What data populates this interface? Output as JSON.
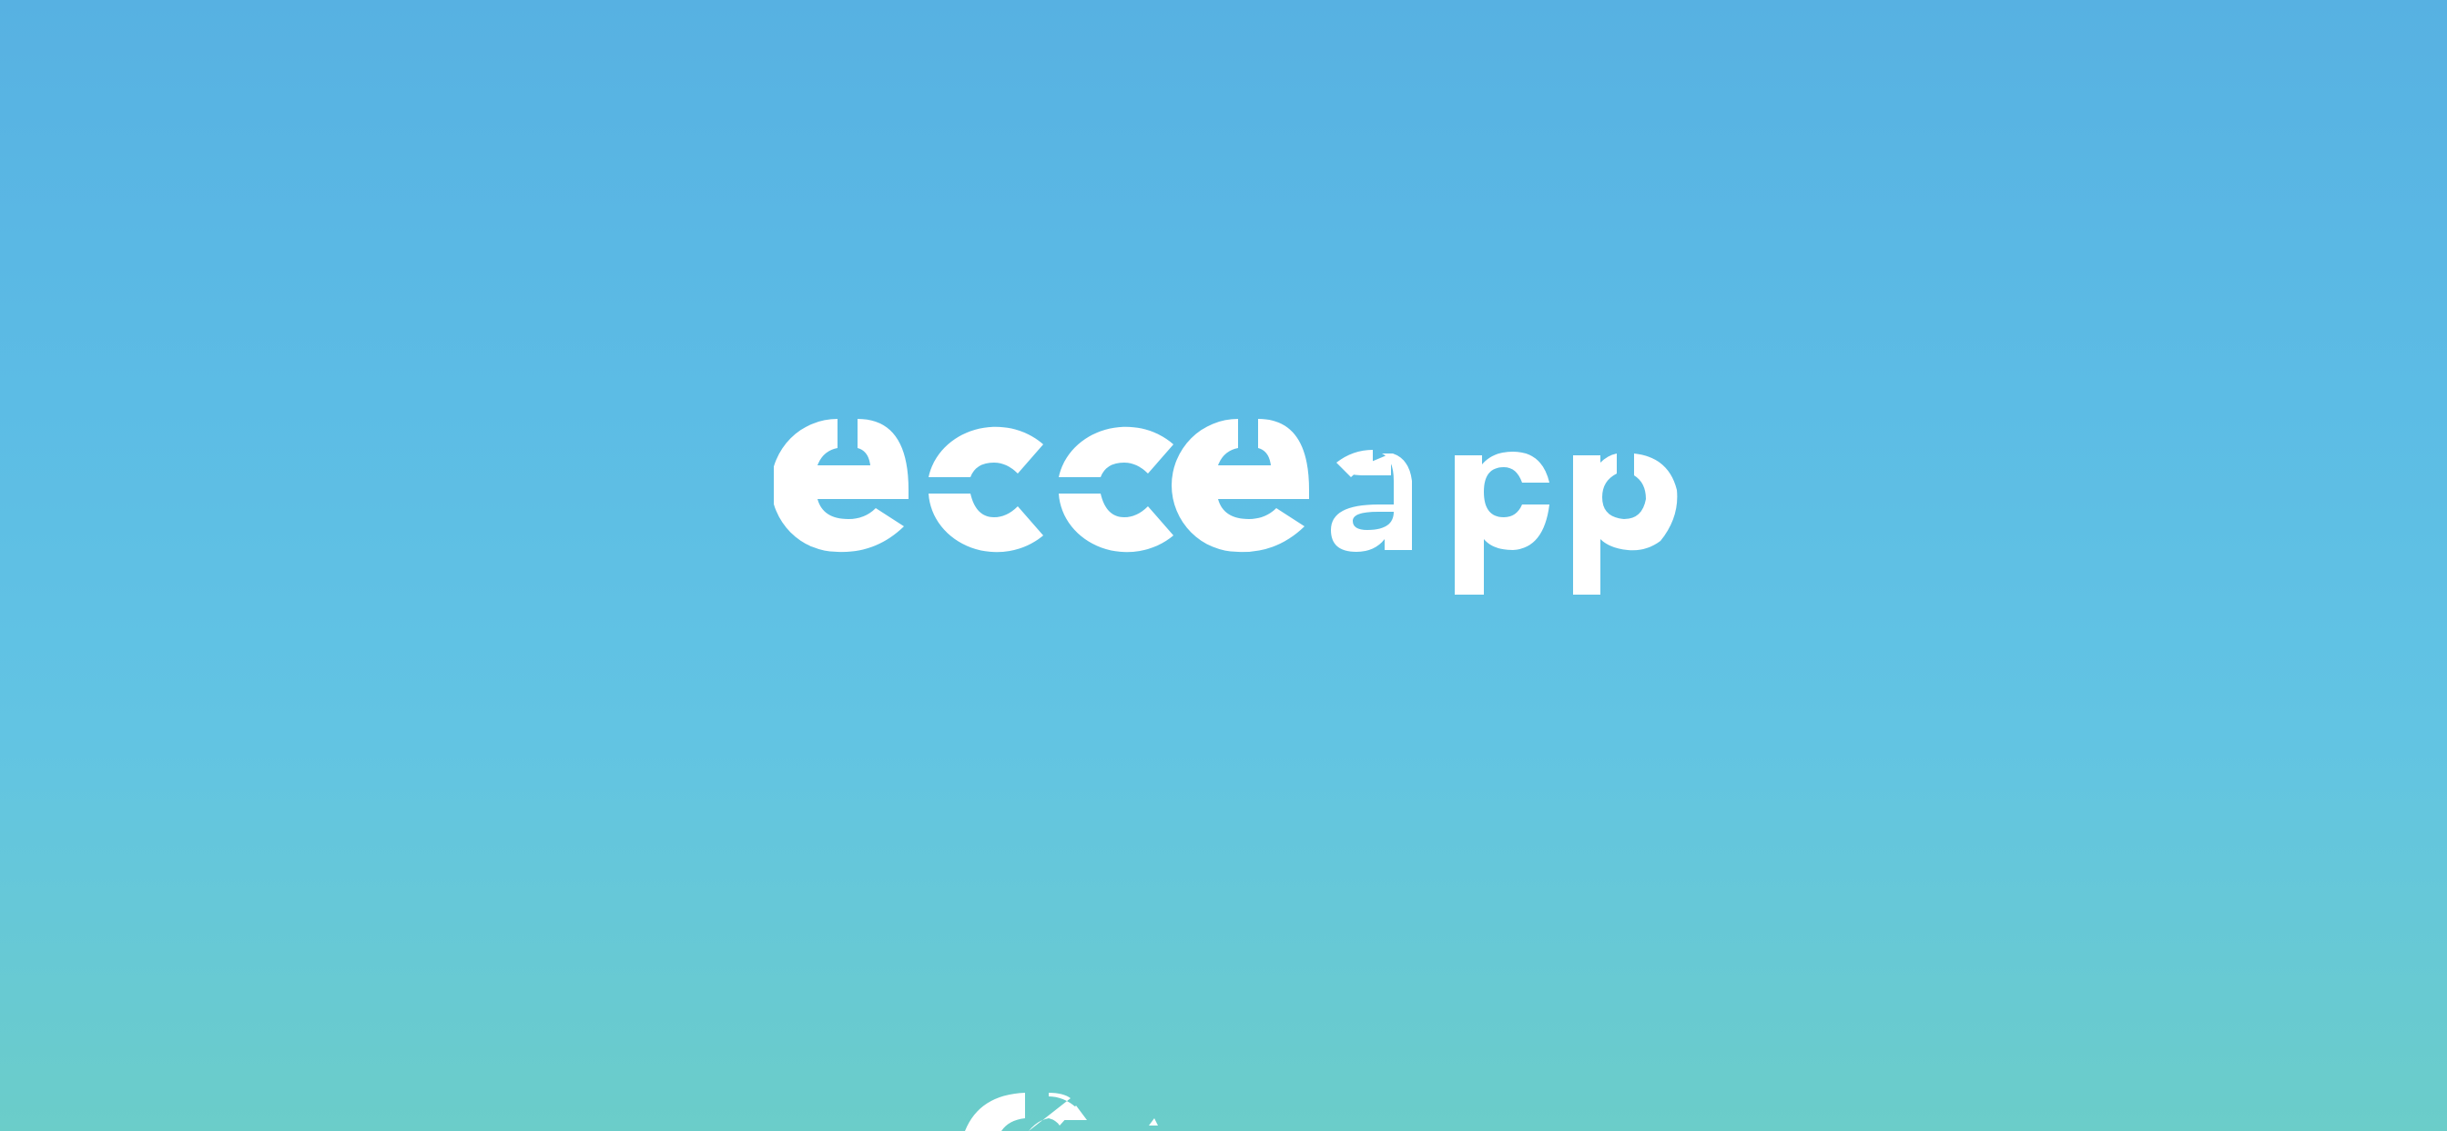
{
  "splash": {
    "logo": {
      "wordmark": "ecce",
      "suffix": "app",
      "icon": "ecce-app-wordmark-logo"
    },
    "bottom_element": {
      "icon": "ecce-logo-mark-icon"
    }
  },
  "colors": {
    "gradient_top": "#57b1e2",
    "gradient_mid": "#5cbce5",
    "gradient_bottom": "#6bcdc9",
    "logo": "#ffffff"
  }
}
